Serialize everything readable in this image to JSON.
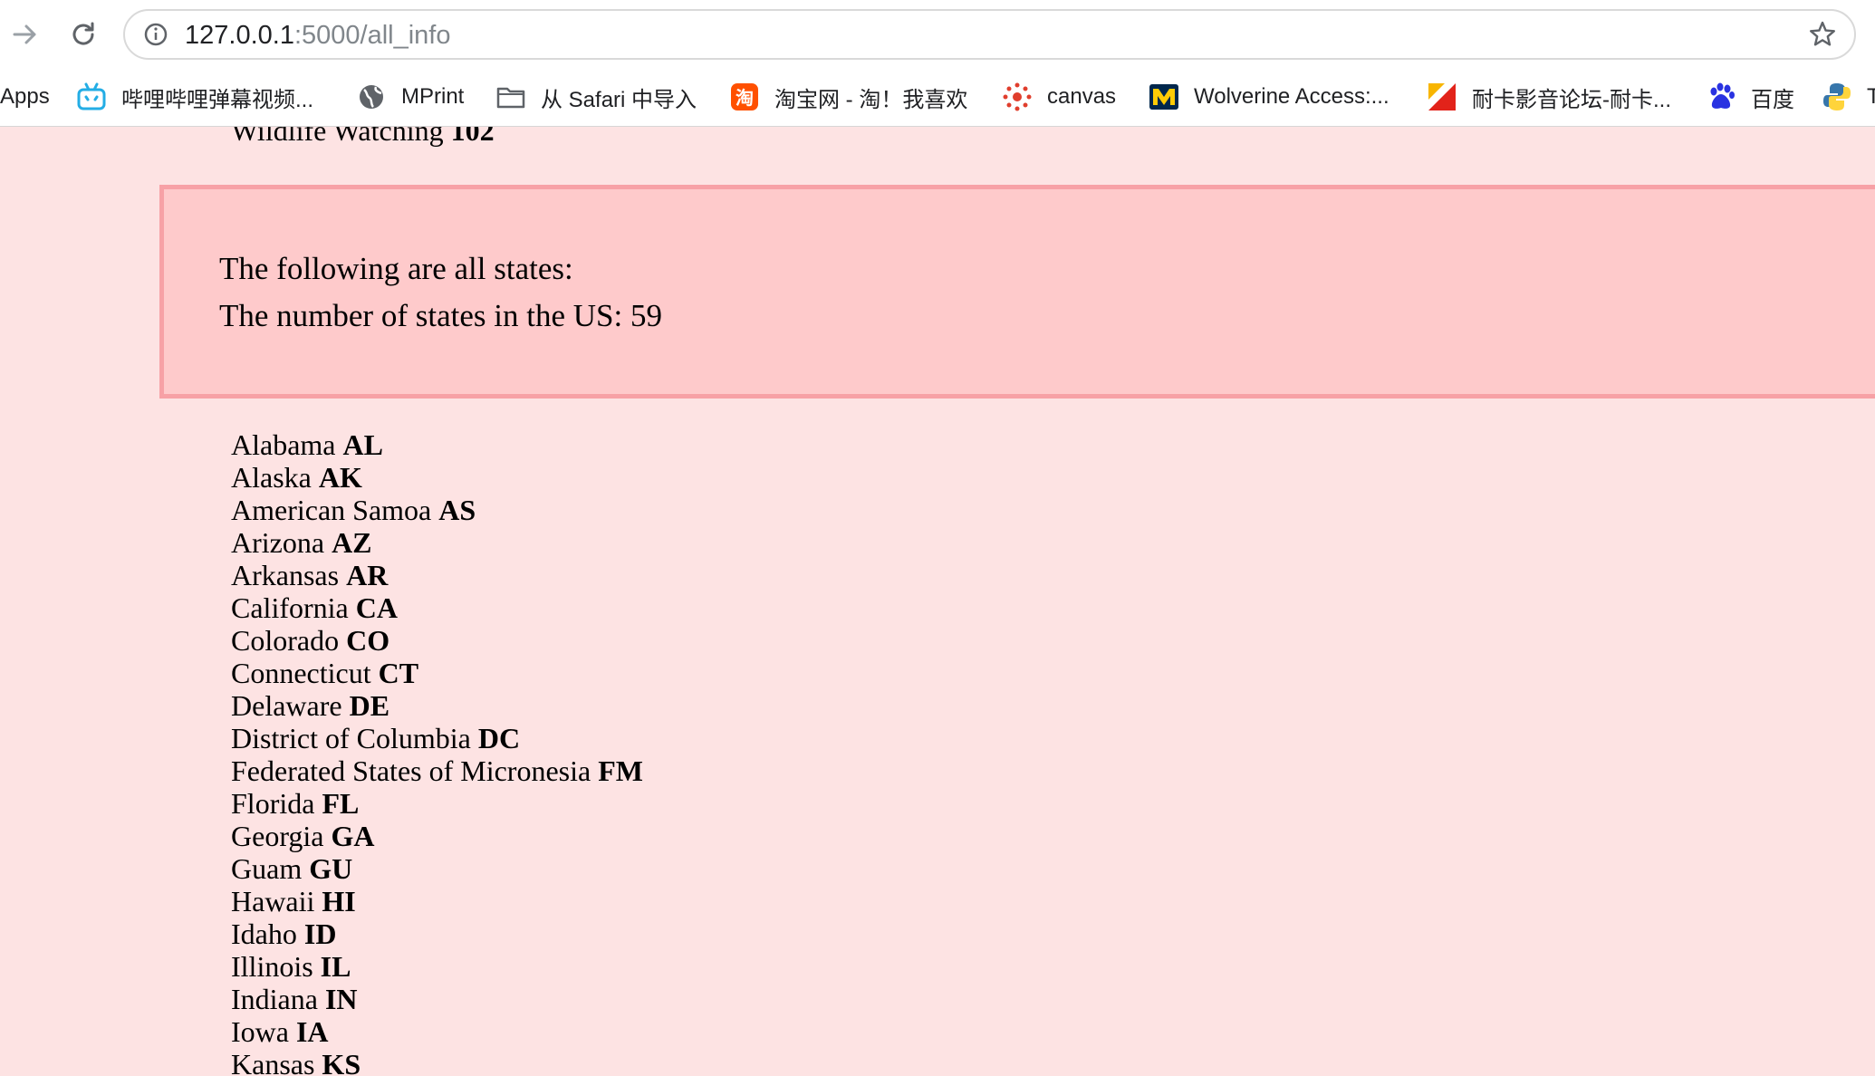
{
  "browser": {
    "url_host": "127.0.0.1",
    "url_path": ":5000/all_info",
    "icons": {
      "forward": "forward-arrow-icon",
      "reload": "reload-icon",
      "site_info": "info-icon",
      "bookmark": "star-icon"
    }
  },
  "bookmarks": [
    {
      "label": "Apps",
      "icon": "apps-icon"
    },
    {
      "label": "哔哩哔哩弹幕视频...",
      "icon": "bilibili-icon"
    },
    {
      "label": "MPrint",
      "icon": "globe-icon"
    },
    {
      "label": "从 Safari 中导入",
      "icon": "folder-icon"
    },
    {
      "label": "淘宝网 - 淘！我喜欢",
      "icon": "taobao-icon"
    },
    {
      "label": "canvas",
      "icon": "canvas-icon"
    },
    {
      "label": "Wolverine Access:...",
      "icon": "michigan-icon"
    },
    {
      "label": "耐卡影音论坛-耐卡...",
      "icon": "naika-icon"
    },
    {
      "label": "百度",
      "icon": "baidu-icon"
    },
    {
      "label": "T",
      "icon": "python-icon"
    }
  ],
  "page": {
    "previous_entry": {
      "name": "Wildlife Watching",
      "code": "102"
    },
    "banner": {
      "line1": "The following are all states:",
      "line2": "The number of states in the US: 59"
    },
    "states": [
      {
        "name": "Alabama",
        "abbr": "AL"
      },
      {
        "name": "Alaska",
        "abbr": "AK"
      },
      {
        "name": "American Samoa",
        "abbr": "AS"
      },
      {
        "name": "Arizona",
        "abbr": "AZ"
      },
      {
        "name": "Arkansas",
        "abbr": "AR"
      },
      {
        "name": "California",
        "abbr": "CA"
      },
      {
        "name": "Colorado",
        "abbr": "CO"
      },
      {
        "name": "Connecticut",
        "abbr": "CT"
      },
      {
        "name": "Delaware",
        "abbr": "DE"
      },
      {
        "name": "District of Columbia",
        "abbr": "DC"
      },
      {
        "name": "Federated States of Micronesia",
        "abbr": "FM"
      },
      {
        "name": "Florida",
        "abbr": "FL"
      },
      {
        "name": "Georgia",
        "abbr": "GA"
      },
      {
        "name": "Guam",
        "abbr": "GU"
      },
      {
        "name": "Hawaii",
        "abbr": "HI"
      },
      {
        "name": "Idaho",
        "abbr": "ID"
      },
      {
        "name": "Illinois",
        "abbr": "IL"
      },
      {
        "name": "Indiana",
        "abbr": "IN"
      },
      {
        "name": "Iowa",
        "abbr": "IA"
      },
      {
        "name": "Kansas",
        "abbr": "KS"
      }
    ]
  },
  "colors": {
    "page_background": "#fde3e3",
    "banner_background": "#fecacb",
    "banner_border": "#f7a1a6"
  }
}
